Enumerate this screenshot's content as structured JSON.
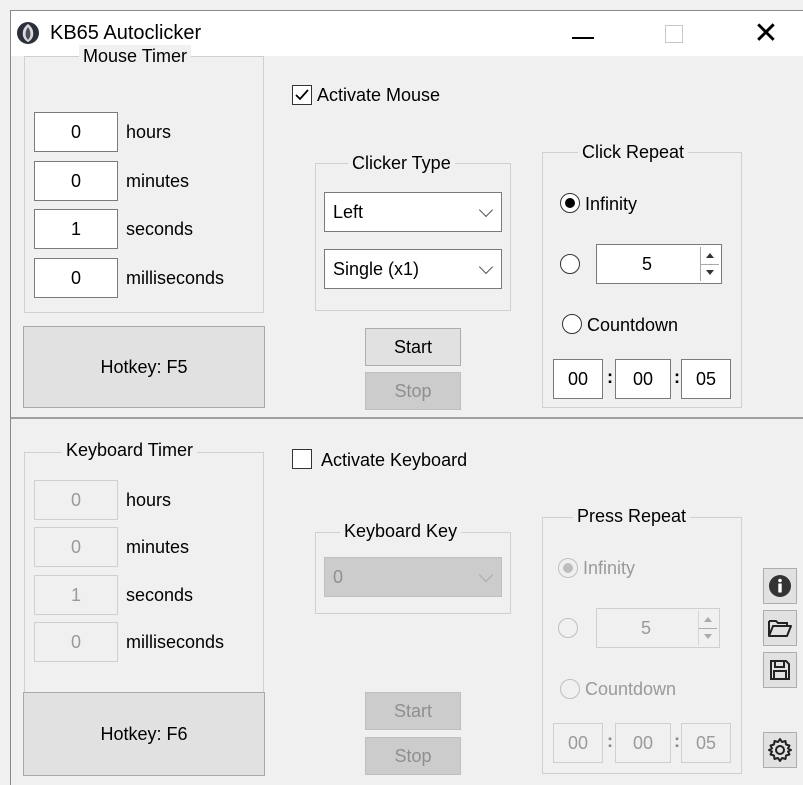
{
  "window": {
    "title": "KB65 Autoclicker"
  },
  "mouse": {
    "timer_title": "Mouse Timer",
    "fields": [
      {
        "value": "0",
        "label": "hours"
      },
      {
        "value": "0",
        "label": "minutes"
      },
      {
        "value": "1",
        "label": "seconds"
      },
      {
        "value": "0",
        "label": "milliseconds"
      }
    ],
    "hotkey_label": "Hotkey: F5",
    "activate_label": "Activate Mouse",
    "activate_checked": true,
    "clicker_type_title": "Clicker Type",
    "button_select": "Left",
    "click_select": "Single (x1)",
    "start_label": "Start",
    "stop_label": "Stop",
    "repeat": {
      "title": "Click Repeat",
      "infinity_label": "Infinity",
      "count_value": "5",
      "countdown_label": "Countdown",
      "countdown": [
        "00",
        "00",
        "05"
      ],
      "selected": "infinity"
    }
  },
  "keyboard": {
    "timer_title": "Keyboard Timer",
    "fields": [
      {
        "value": "0",
        "label": "hours"
      },
      {
        "value": "0",
        "label": "minutes"
      },
      {
        "value": "1",
        "label": "seconds"
      },
      {
        "value": "0",
        "label": "milliseconds"
      }
    ],
    "hotkey_label": "Hotkey: F6",
    "activate_label": "Activate Keyboard",
    "activate_checked": false,
    "key_title": "Keyboard Key",
    "key_select": "0",
    "start_label": "Start",
    "stop_label": "Stop",
    "repeat": {
      "title": "Press Repeat",
      "infinity_label": "Infinity",
      "count_value": "5",
      "countdown_label": "Countdown",
      "countdown": [
        "00",
        "00",
        "05"
      ],
      "selected": "infinity"
    }
  },
  "side_buttons": [
    "info-icon",
    "folder-open-icon",
    "save-icon",
    "settings-gear-icon"
  ],
  "colors": {
    "background": "#f0f0f0",
    "titlebar": "#ffffff",
    "disabled_text": "#9a9a9a"
  }
}
